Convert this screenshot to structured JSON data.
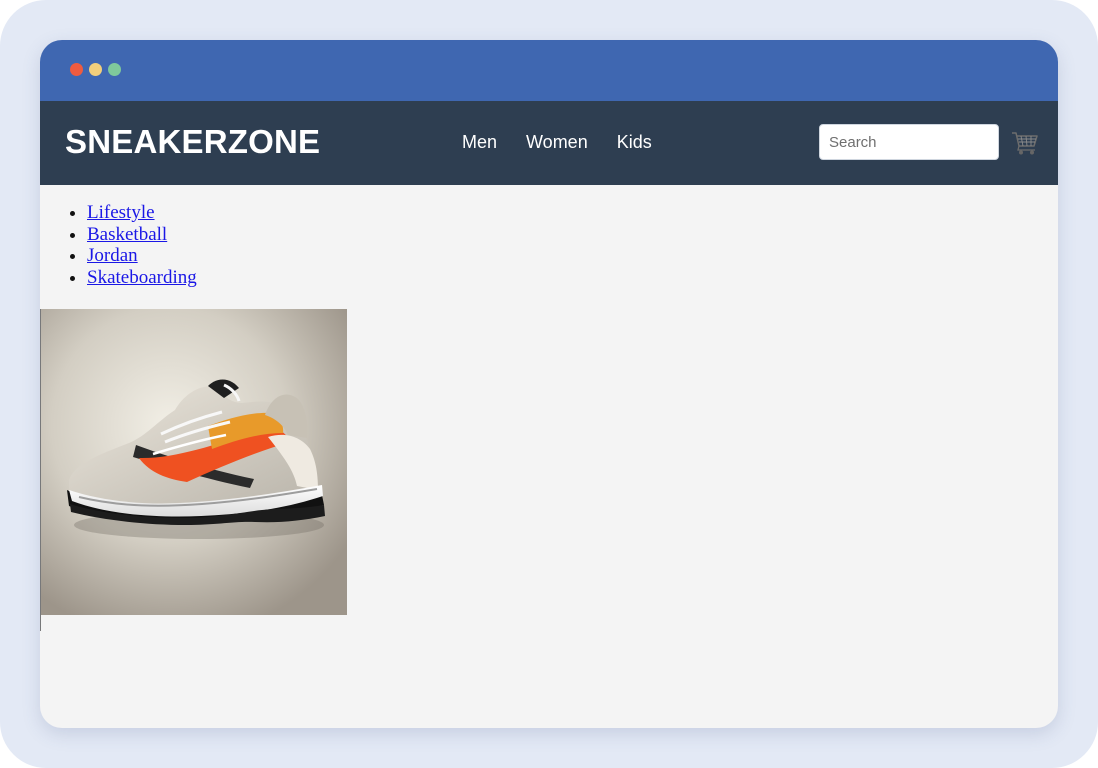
{
  "brand": {
    "name": "SNEAKERZONE"
  },
  "nav": {
    "links": [
      {
        "label": "Men"
      },
      {
        "label": "Women"
      },
      {
        "label": "Kids"
      }
    ]
  },
  "search": {
    "placeholder": "Search",
    "value": ""
  },
  "cart": {
    "icon": "shopping-cart-icon"
  },
  "categories": [
    {
      "label": "Lifestyle"
    },
    {
      "label": "Basketball"
    },
    {
      "label": "Jordan"
    },
    {
      "label": "Skateboarding"
    }
  ],
  "product": {
    "image": "sneaker-photo"
  },
  "colors": {
    "titlebar": "#3f67b1",
    "navbar": "#2e3e51",
    "page_background": "#f4f4f4",
    "link": "#1a17e6"
  }
}
